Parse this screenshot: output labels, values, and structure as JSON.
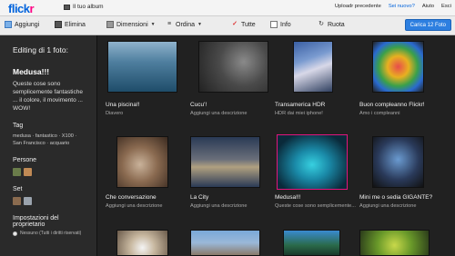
{
  "header": {
    "logo_part1": "flick",
    "logo_part2": "r",
    "album_link": "Il tuo album",
    "links": [
      "Uploadr precedente",
      "Sei nuovo?",
      "Aiuto",
      "Esci"
    ]
  },
  "toolbar": {
    "add": "Aggiungi",
    "delete": "Elimina",
    "dimensions": "Dimensioni",
    "order": "Ordina",
    "all": "Tutte",
    "info": "Info",
    "rotate": "Ruota",
    "upload": "Carica 12 Foto"
  },
  "sidebar": {
    "heading": "Editing di 1 foto:",
    "title": "Medusa!!!",
    "description": "Queste cose sono semplicemente fantastiche ... il colore, il movimento ... WOW!",
    "tags_label": "Tag",
    "tags": "medusa · fantastico · X100 · San Francisco · acquario",
    "people_label": "Persone",
    "sets_label": "Set",
    "owner_label": "Impostazioni del proprietario",
    "owner_value": "Nessuno (Tutti i diritti riservati)"
  },
  "photos": [
    {
      "title": "Una piscina!!",
      "desc": "Diavero"
    },
    {
      "title": "Cucu'!",
      "desc": "Aggiungi una descrizione"
    },
    {
      "title": "Transamerica HDR",
      "desc": "HDR dai miei iphone!"
    },
    {
      "title": "Buon compleanno Flickr!",
      "desc": "Amo i compleanni"
    },
    {
      "title": "Che conversazione",
      "desc": "Aggiungi una descrizione"
    },
    {
      "title": "La City",
      "desc": "Aggiungi una descrizione"
    },
    {
      "title": "Medusa!!!",
      "desc": "Queste cose sono semplicemente..."
    },
    {
      "title": "Mini me o sedia GIGANTE?",
      "desc": "Aggiungi una descrizione"
    }
  ],
  "colors": {
    "flickr_blue": "#0063dc",
    "flickr_pink": "#ff0084",
    "selection": "#e2157d",
    "upload_button": "#2d7fe0"
  }
}
